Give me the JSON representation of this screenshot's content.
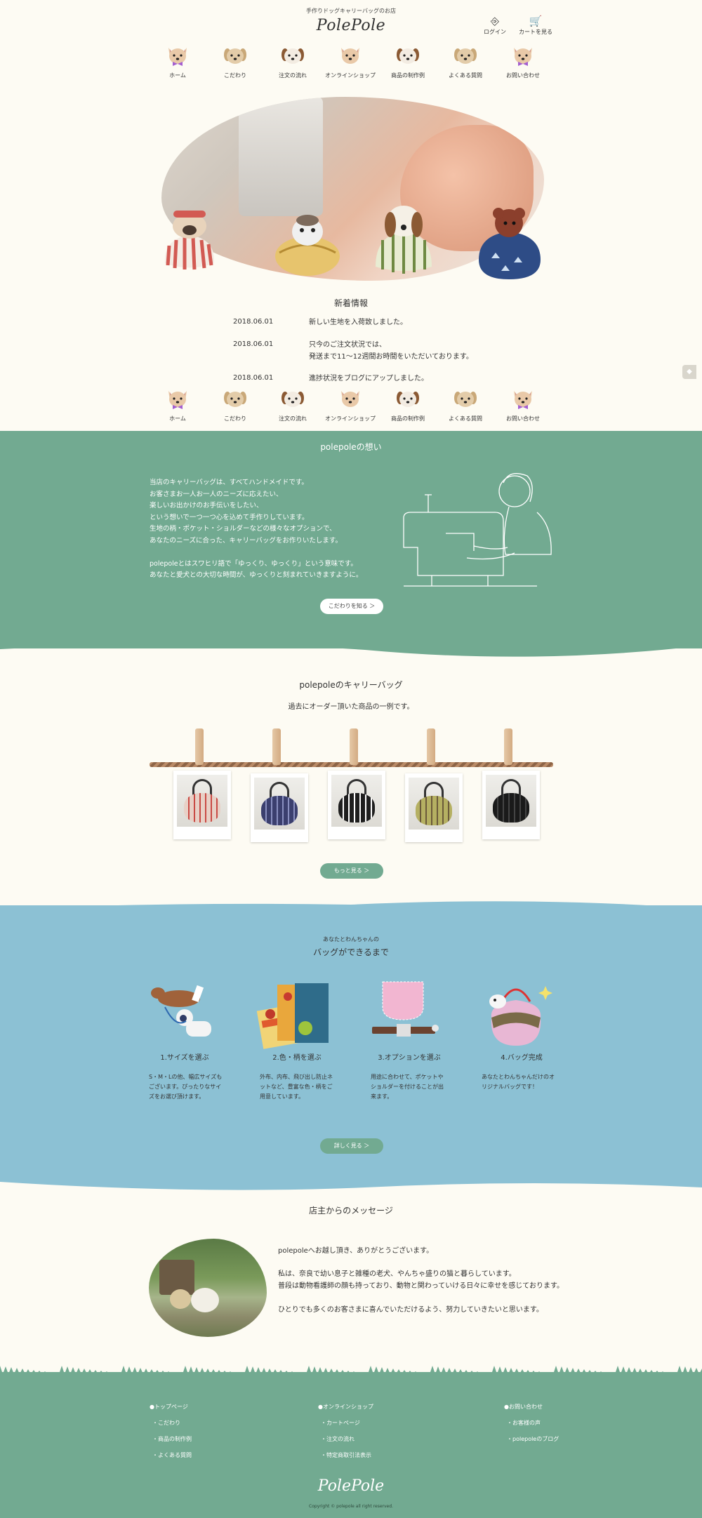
{
  "header": {
    "tagline": "手作りドッグキャリーバッグのお店",
    "logo": "PolePole",
    "login_label": "ログイン",
    "cart_label": "カートを見る"
  },
  "nav": {
    "items": [
      {
        "label": "ホーム",
        "dog": "chihuahua-bow"
      },
      {
        "label": "こだわり",
        "dog": "beige-dog"
      },
      {
        "label": "注文の流れ",
        "dog": "spotted-dog"
      },
      {
        "label": "オンラインショップ",
        "dog": "chihuahua"
      },
      {
        "label": "商品の制作例",
        "dog": "spotted-dog"
      },
      {
        "label": "よくある質問",
        "dog": "beige-dog"
      },
      {
        "label": "お問い合わせ",
        "dog": "chihuahua-bow"
      }
    ]
  },
  "news": {
    "title": "新着情報",
    "items": [
      {
        "date": "2018.06.01",
        "lines": [
          "新しい生地を入荷致しました。"
        ]
      },
      {
        "date": "2018.06.01",
        "lines": [
          "只今のご注文状況では、",
          "発送まで11〜12週間お時間をいただいております。"
        ]
      },
      {
        "date": "2018.06.01",
        "lines": [
          "進捗状況をブログにアップしました。"
        ]
      }
    ]
  },
  "omoi": {
    "title": "polepoleの想い",
    "text": "当店のキャリーバッグは、すべてハンドメイドです。\nお客さまお一人お一人のニーズに応えたい、\n楽しいお出かけのお手伝いをしたい、\nという想いで一つ一つ心を込めて手作りしています。\n生地の柄・ポケット・ショルダーなどの様々なオプションで、\nあなたのニーズに合った、キャリーバッグをお作りいたします。\n\npolepoleとはスワヒリ語で「ゆっくり、ゆっくり」という意味です。\nあなたと愛犬との大切な時間が、ゆっくりと刻まれていきますように。",
    "button": "こだわりを知る ＞"
  },
  "bags": {
    "title": "polepoleのキャリーバッグ",
    "subtitle": "過去にオーダー頂いた商品の一例です。",
    "photos": [
      {
        "color": "#e8d0c6",
        "stripe": "#c94a44"
      },
      {
        "color": "#3b3f6e",
        "stripe": "#8a90c0"
      },
      {
        "color": "#1e1e1e",
        "stripe": "#ffffff"
      },
      {
        "color": "#b5b062",
        "stripe": "#6b5a3a"
      },
      {
        "color": "#1a1a1a",
        "stripe": "#444444"
      }
    ],
    "button": "もっと見る ＞"
  },
  "process": {
    "subtitle": "あなたとわんちゃんの",
    "title": "バッグができるまで",
    "steps": [
      {
        "title": "1.サイズを選ぶ",
        "desc": "S・M・Lの他、幅広サイズも\nございます。ぴったりなサイ\nズをお選び頂けます。"
      },
      {
        "title": "2.色・柄を選ぶ",
        "desc": "外布、内布、飛び出し防止ネ\nットなど、豊富な色・柄をご\n用意しています。"
      },
      {
        "title": "3.オプションを選ぶ",
        "desc": "用途に合わせて、ポケットや\nショルダーを付けることが出\n来ます。"
      },
      {
        "title": "4.バッグ完成",
        "desc": "あなたとわんちゃんだけのオ\nリジナルバッグです！"
      }
    ],
    "button": "詳しく見る ＞"
  },
  "message": {
    "title": "店主からのメッセージ",
    "lines": [
      "polepoleへお越し頂き、ありがとうございます。",
      "私は、奈良で幼い息子と雑種の老犬、やんちゃ盛りの猫と暮らしています。",
      "普段は動物看護師の顔も持っており、動物と関わっていける日々に幸せを感じております。",
      "ひとりでも多くのお客さまに喜んでいただけるよう、努力していきたいと思います。"
    ]
  },
  "footer": {
    "columns": [
      {
        "head": "●トップページ",
        "links": [
          "・こだわり",
          "・商品の制作例",
          "・よくある質問"
        ]
      },
      {
        "head": "●オンラインショップ",
        "links": [
          "・カートページ",
          "・注文の流れ",
          "・特定商取引法表示"
        ]
      },
      {
        "head": "●お問い合わせ",
        "links": [
          "・お客様の声",
          "・polepoleのブログ"
        ]
      }
    ],
    "logo": "PolePole",
    "copyright": "Copyright © polepole all right reserved."
  },
  "colors": {
    "green": "#72aa91",
    "blue": "#8cc1d4",
    "cream": "#fdfbf3"
  }
}
